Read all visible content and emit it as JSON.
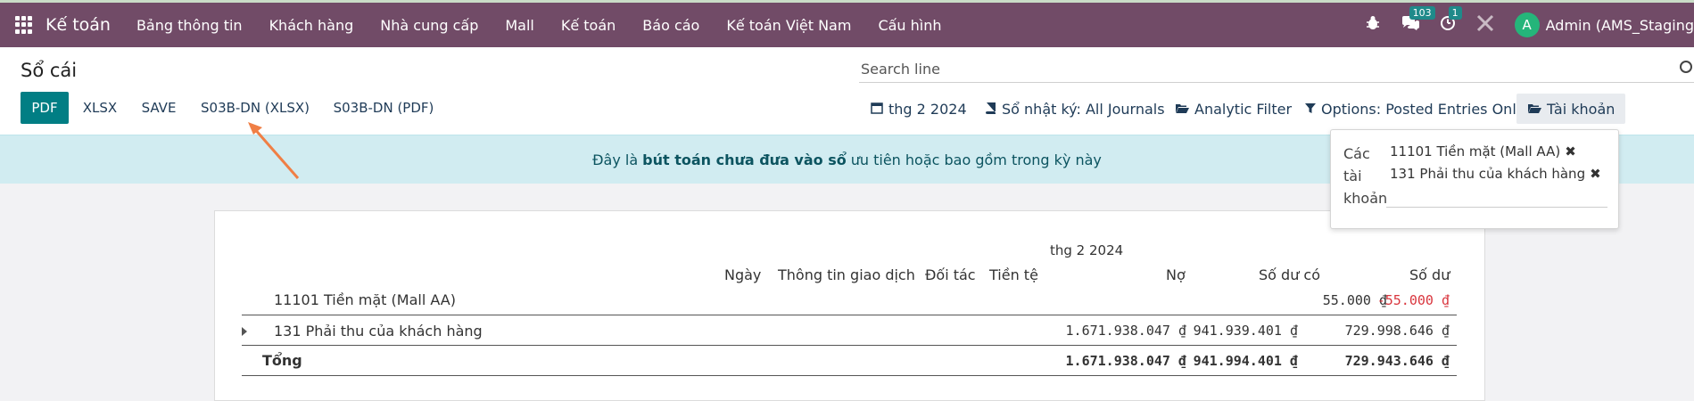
{
  "navbar": {
    "brand": "Kế toán",
    "menu": [
      "Bảng thông tin",
      "Khách hàng",
      "Nhà cung cấp",
      "Mall",
      "Kế toán",
      "Báo cáo",
      "Kế toán Việt Nam",
      "Cấu hình"
    ],
    "messages_badge": "103",
    "activity_badge": "1",
    "avatar_letter": "A",
    "user": "Admin (AMS_Staging"
  },
  "control": {
    "title": "Sổ cái",
    "search_placeholder": "Search line",
    "buttons": [
      "PDF",
      "XLSX",
      "SAVE",
      "S03B-DN (XLSX)",
      "S03B-DN (PDF)"
    ],
    "filters": {
      "date": "thg 2 2024",
      "journals": "Sổ nhật ký: All Journals",
      "analytic": "Analytic Filter",
      "options": "Options: Posted Entries Only",
      "accounts": "Tài khoản"
    }
  },
  "banner": {
    "pre": "Đây là",
    "bold": "bút toán chưa đưa vào sổ",
    "post": "ưu tiên hoặc bao gồm trong kỳ này"
  },
  "popover": {
    "label_lines": [
      "Các",
      "tài",
      "khoản"
    ],
    "tags": [
      "11101 Tiền mặt (Mall AA)",
      "131 Phải thu của khách hàng"
    ]
  },
  "report": {
    "period": "thg 2 2024",
    "headers": {
      "date": "Ngày",
      "info": "Thông tin giao dịch",
      "partner": "Đối tác",
      "currency": "Tiền tệ",
      "debit": "Nợ",
      "credit": "Số dư có",
      "balance": "Số dư"
    },
    "rows": [
      {
        "name": "11101 Tiền mặt (Mall AA)",
        "debit": "",
        "credit": "55.000 ₫",
        "balance": "-55.000 ₫"
      },
      {
        "name": "131 Phải thu của khách hàng",
        "debit": "1.671.938.047 ₫",
        "credit": "941.939.401 ₫",
        "balance": "729.998.646 ₫"
      }
    ],
    "total": {
      "name": "Tổng",
      "debit": "1.671.938.047 ₫",
      "credit": "941.994.401 ₫",
      "balance": "729.943.646 ₫"
    }
  },
  "colors": {
    "navbar": "#714b67",
    "primary": "#017e84",
    "banner": "#d1ecf1",
    "negative": "#d9363e",
    "annotation_arrow": "#f07f45"
  }
}
